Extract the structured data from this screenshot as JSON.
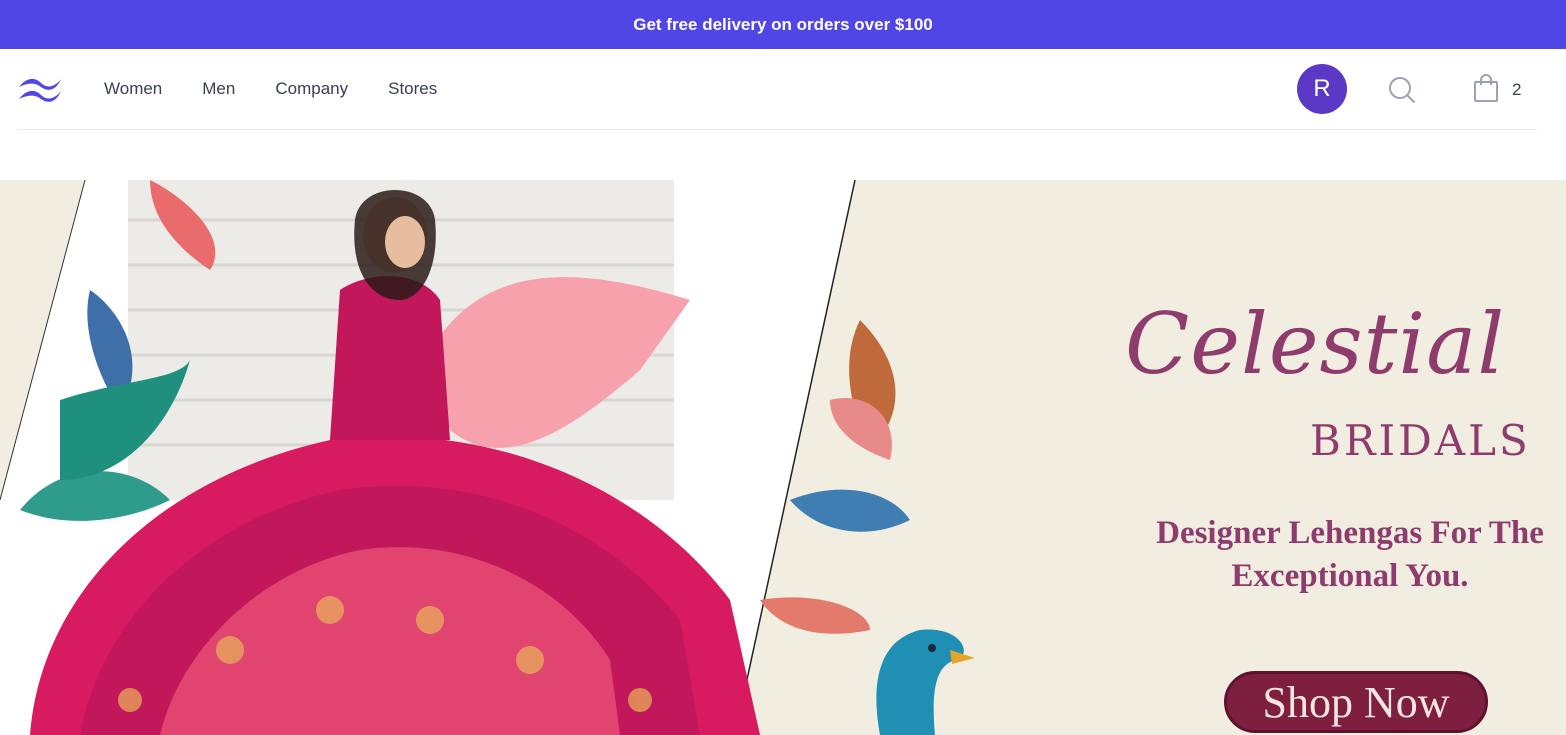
{
  "promo": {
    "text": "Get free delivery on orders over $100"
  },
  "brand": {
    "logo_icon": "wave-logo-icon",
    "accent": "#4f46e5"
  },
  "nav": {
    "links": [
      {
        "label": "Women"
      },
      {
        "label": "Men"
      },
      {
        "label": "Company"
      },
      {
        "label": "Stores"
      }
    ]
  },
  "user": {
    "initial": "R",
    "avatar_color": "#5b39c6"
  },
  "search": {
    "icon": "search-icon"
  },
  "cart": {
    "icon": "shopping-bag-icon",
    "count": "2"
  },
  "hero": {
    "brand_script": "Celestial",
    "brand_caps": "BRIDALS",
    "tagline": "Designer Lehengas For The\nExceptional You.",
    "cta_label": "Shop Now",
    "background": "#f1ede0",
    "text_color": "#8e3b6e",
    "cta_color": "#7e1f3f"
  }
}
